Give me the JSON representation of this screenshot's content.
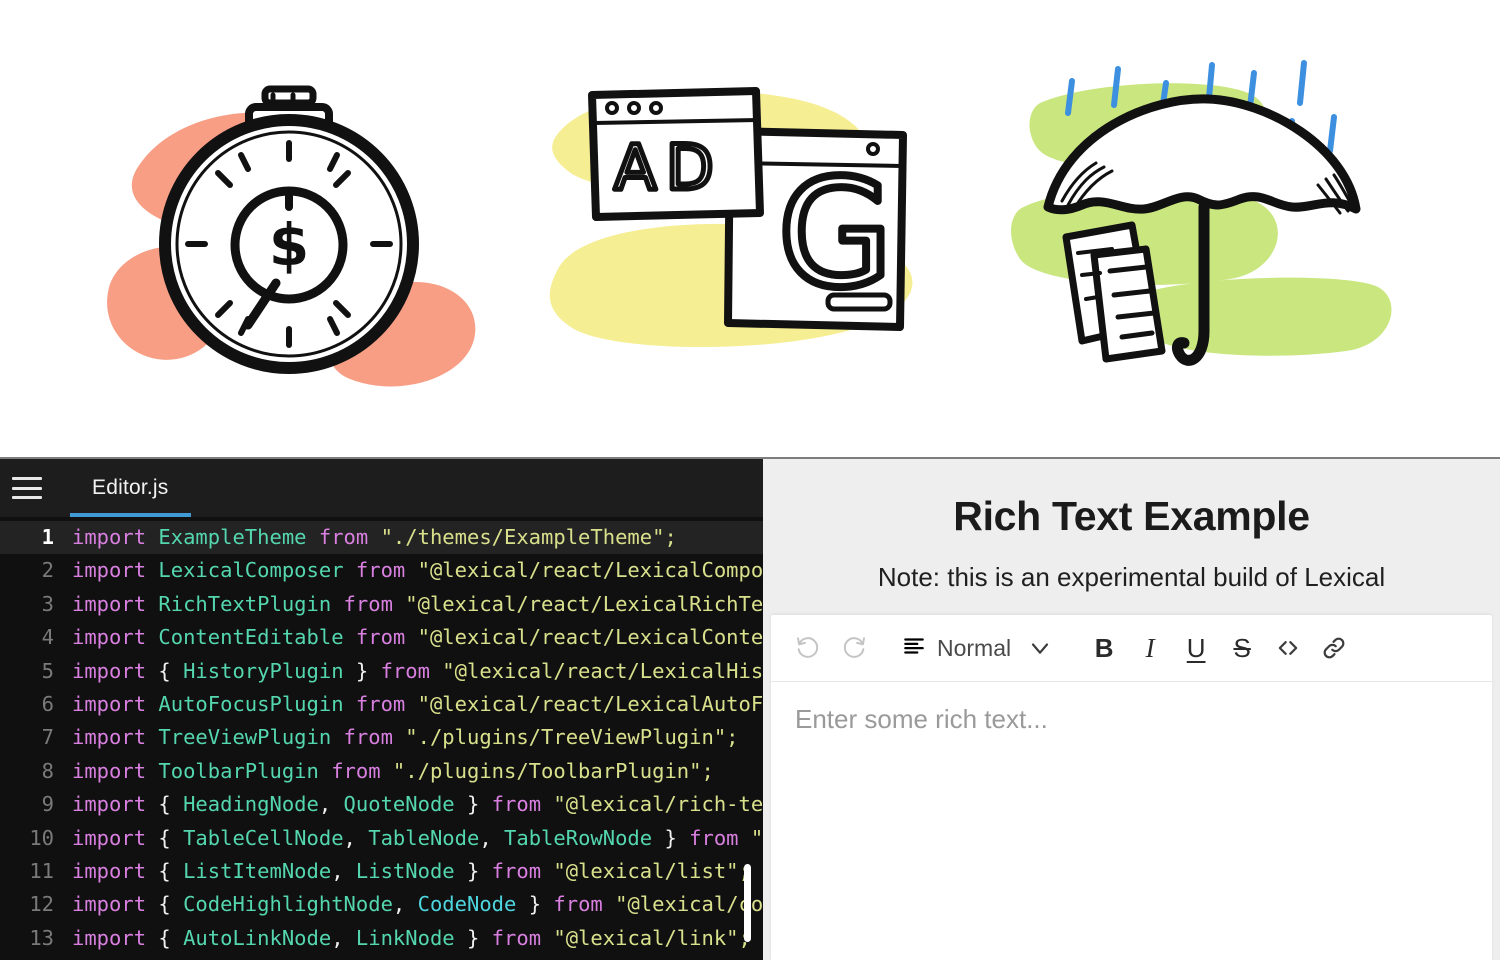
{
  "illustrations": [
    {
      "name": "stopwatch-money",
      "alt": "Hand drawn stopwatch with a dollar sign on its dial",
      "blob_color": "#F79E85",
      "ink_color": "#111111",
      "symbol": "$"
    },
    {
      "name": "ad-browser-windows",
      "alt": "Two hand drawn browser windows labelled AD and G",
      "blob_color": "#F6EE93",
      "ink_color": "#111111",
      "labels": [
        "A",
        "D",
        "G"
      ]
    },
    {
      "name": "umbrella-documents-rain",
      "alt": "Hand drawn umbrella sheltering documents from rain",
      "blob_color": "#C9E67F",
      "ink_color": "#111111",
      "rain_color": "#3D8FE0"
    }
  ],
  "code_panel": {
    "menu_icon": "hamburger-icon",
    "tabs": [
      {
        "label": "Editor.js",
        "active": true
      }
    ],
    "active_tab_underline_color": "#3f9ad6",
    "scrollbar_visible": true,
    "lines": [
      {
        "n": "1",
        "active": true,
        "tokens": [
          {
            "t": "import",
            "c": "kw"
          },
          {
            "t": " ",
            "c": "pun"
          },
          {
            "t": "ExampleTheme",
            "c": "id"
          },
          {
            "t": " ",
            "c": "pun"
          },
          {
            "t": "from",
            "c": "kw"
          },
          {
            "t": " ",
            "c": "pun"
          },
          {
            "t": "\"./themes/ExampleTheme\";",
            "c": "str"
          }
        ]
      },
      {
        "n": "2",
        "active": false,
        "tokens": [
          {
            "t": "import",
            "c": "kw"
          },
          {
            "t": " ",
            "c": "pun"
          },
          {
            "t": "LexicalComposer",
            "c": "id"
          },
          {
            "t": " ",
            "c": "pun"
          },
          {
            "t": "from",
            "c": "kw"
          },
          {
            "t": " ",
            "c": "pun"
          },
          {
            "t": "\"@lexical/react/LexicalComposer\";",
            "c": "str"
          }
        ]
      },
      {
        "n": "3",
        "active": false,
        "tokens": [
          {
            "t": "import",
            "c": "kw"
          },
          {
            "t": " ",
            "c": "pun"
          },
          {
            "t": "RichTextPlugin",
            "c": "id"
          },
          {
            "t": " ",
            "c": "pun"
          },
          {
            "t": "from",
            "c": "kw"
          },
          {
            "t": " ",
            "c": "pun"
          },
          {
            "t": "\"@lexical/react/LexicalRichTextPlugin\";",
            "c": "str"
          }
        ]
      },
      {
        "n": "4",
        "active": false,
        "tokens": [
          {
            "t": "import",
            "c": "kw"
          },
          {
            "t": " ",
            "c": "pun"
          },
          {
            "t": "ContentEditable",
            "c": "id"
          },
          {
            "t": " ",
            "c": "pun"
          },
          {
            "t": "from",
            "c": "kw"
          },
          {
            "t": " ",
            "c": "pun"
          },
          {
            "t": "\"@lexical/react/LexicalContentEditable\";",
            "c": "str"
          }
        ]
      },
      {
        "n": "5",
        "active": false,
        "tokens": [
          {
            "t": "import",
            "c": "kw"
          },
          {
            "t": " ",
            "c": "pun"
          },
          {
            "t": "{ ",
            "c": "pun"
          },
          {
            "t": "HistoryPlugin",
            "c": "id"
          },
          {
            "t": " }",
            "c": "pun"
          },
          {
            "t": " ",
            "c": "pun"
          },
          {
            "t": "from",
            "c": "kw"
          },
          {
            "t": " ",
            "c": "pun"
          },
          {
            "t": "\"@lexical/react/LexicalHistoryPlugin\";",
            "c": "str"
          }
        ]
      },
      {
        "n": "6",
        "active": false,
        "tokens": [
          {
            "t": "import",
            "c": "kw"
          },
          {
            "t": " ",
            "c": "pun"
          },
          {
            "t": "AutoFocusPlugin",
            "c": "id"
          },
          {
            "t": " ",
            "c": "pun"
          },
          {
            "t": "from",
            "c": "kw"
          },
          {
            "t": " ",
            "c": "pun"
          },
          {
            "t": "\"@lexical/react/LexicalAutoFocusPlugin\";",
            "c": "str"
          }
        ]
      },
      {
        "n": "7",
        "active": false,
        "tokens": [
          {
            "t": "import",
            "c": "kw"
          },
          {
            "t": " ",
            "c": "pun"
          },
          {
            "t": "TreeViewPlugin",
            "c": "id"
          },
          {
            "t": " ",
            "c": "pun"
          },
          {
            "t": "from",
            "c": "kw"
          },
          {
            "t": " ",
            "c": "pun"
          },
          {
            "t": "\"./plugins/TreeViewPlugin\";",
            "c": "str"
          }
        ]
      },
      {
        "n": "8",
        "active": false,
        "tokens": [
          {
            "t": "import",
            "c": "kw"
          },
          {
            "t": " ",
            "c": "pun"
          },
          {
            "t": "ToolbarPlugin",
            "c": "id"
          },
          {
            "t": " ",
            "c": "pun"
          },
          {
            "t": "from",
            "c": "kw"
          },
          {
            "t": " ",
            "c": "pun"
          },
          {
            "t": "\"./plugins/ToolbarPlugin\";",
            "c": "str"
          }
        ]
      },
      {
        "n": "9",
        "active": false,
        "tokens": [
          {
            "t": "import",
            "c": "kw"
          },
          {
            "t": " ",
            "c": "pun"
          },
          {
            "t": "{ ",
            "c": "pun"
          },
          {
            "t": "HeadingNode",
            "c": "id"
          },
          {
            "t": ", ",
            "c": "pun"
          },
          {
            "t": "QuoteNode",
            "c": "id"
          },
          {
            "t": " }",
            "c": "pun"
          },
          {
            "t": " ",
            "c": "pun"
          },
          {
            "t": "from",
            "c": "kw"
          },
          {
            "t": " ",
            "c": "pun"
          },
          {
            "t": "\"@lexical/rich-text\";",
            "c": "str"
          }
        ]
      },
      {
        "n": "10",
        "active": false,
        "tokens": [
          {
            "t": "import",
            "c": "kw"
          },
          {
            "t": " ",
            "c": "pun"
          },
          {
            "t": "{ ",
            "c": "pun"
          },
          {
            "t": "TableCellNode",
            "c": "id"
          },
          {
            "t": ", ",
            "c": "pun"
          },
          {
            "t": "TableNode",
            "c": "id"
          },
          {
            "t": ", ",
            "c": "pun"
          },
          {
            "t": "TableRowNode",
            "c": "id"
          },
          {
            "t": " }",
            "c": "pun"
          },
          {
            "t": " ",
            "c": "pun"
          },
          {
            "t": "from",
            "c": "kw"
          },
          {
            "t": " ",
            "c": "pun"
          },
          {
            "t": "\"@lexical/table\";",
            "c": "str"
          }
        ]
      },
      {
        "n": "11",
        "active": false,
        "tokens": [
          {
            "t": "import",
            "c": "kw"
          },
          {
            "t": " ",
            "c": "pun"
          },
          {
            "t": "{ ",
            "c": "pun"
          },
          {
            "t": "ListItemNode",
            "c": "id"
          },
          {
            "t": ", ",
            "c": "pun"
          },
          {
            "t": "ListNode",
            "c": "id"
          },
          {
            "t": " }",
            "c": "pun"
          },
          {
            "t": " ",
            "c": "pun"
          },
          {
            "t": "from",
            "c": "kw"
          },
          {
            "t": " ",
            "c": "pun"
          },
          {
            "t": "\"@lexical/list\";",
            "c": "str"
          }
        ]
      },
      {
        "n": "12",
        "active": false,
        "tokens": [
          {
            "t": "import",
            "c": "kw"
          },
          {
            "t": " ",
            "c": "pun"
          },
          {
            "t": "{ ",
            "c": "pun"
          },
          {
            "t": "CodeHighlightNode",
            "c": "id"
          },
          {
            "t": ", ",
            "c": "pun"
          },
          {
            "t": "CodeNode",
            "c": "cy"
          },
          {
            "t": " }",
            "c": "pun"
          },
          {
            "t": " ",
            "c": "pun"
          },
          {
            "t": "from",
            "c": "kw"
          },
          {
            "t": " ",
            "c": "pun"
          },
          {
            "t": "\"@lexical/code\";",
            "c": "str"
          }
        ]
      },
      {
        "n": "13",
        "active": false,
        "tokens": [
          {
            "t": "import",
            "c": "kw"
          },
          {
            "t": " ",
            "c": "pun"
          },
          {
            "t": "{ ",
            "c": "pun"
          },
          {
            "t": "AutoLinkNode",
            "c": "id"
          },
          {
            "t": ", ",
            "c": "pun"
          },
          {
            "t": "LinkNode",
            "c": "id"
          },
          {
            "t": " }",
            "c": "pun"
          },
          {
            "t": " ",
            "c": "pun"
          },
          {
            "t": "from",
            "c": "kw"
          },
          {
            "t": " ",
            "c": "pun"
          },
          {
            "t": "\"@lexical/link\";",
            "c": "str"
          }
        ]
      }
    ]
  },
  "editor_panel": {
    "title": "Rich Text Example",
    "subtitle": "Note: this is an experimental build of Lexical",
    "toolbar": {
      "undo_label": "Undo",
      "redo_label": "Redo",
      "block_format": "Normal",
      "bold_label": "B",
      "italic_label": "I",
      "underline_label": "U",
      "strikethrough_label": "S",
      "code_label": "<>",
      "link_label": "Link"
    },
    "placeholder": "Enter some rich text..."
  }
}
